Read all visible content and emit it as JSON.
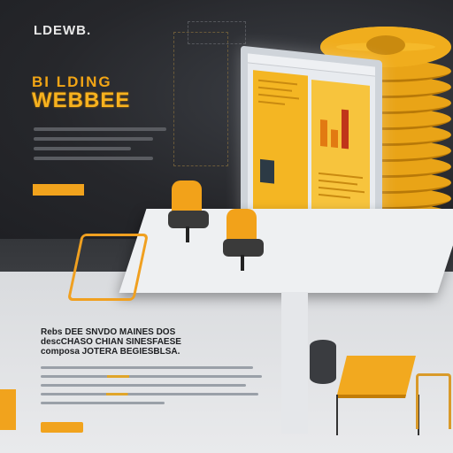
{
  "header": {
    "logo_text": "LDEWB."
  },
  "hero": {
    "headline_line1": "BI LDING",
    "headline_line2": "WEBBEE",
    "cta_label": ""
  },
  "bottom": {
    "title": "Rebs DEE SNVDO MAINES DOS\ndescCHASO CHIAN SINESFAESE\ncomposa JOTERA BEGIESBLSA.",
    "cta_label": ""
  },
  "colors": {
    "accent": "#f1a31d",
    "dark_bg": "#26272b",
    "light_bg": "#e9eaec"
  },
  "icons": {
    "monitor": "monitor-illustration",
    "coins": "coin-stack-illustration",
    "chair": "office-chair-illustration"
  }
}
